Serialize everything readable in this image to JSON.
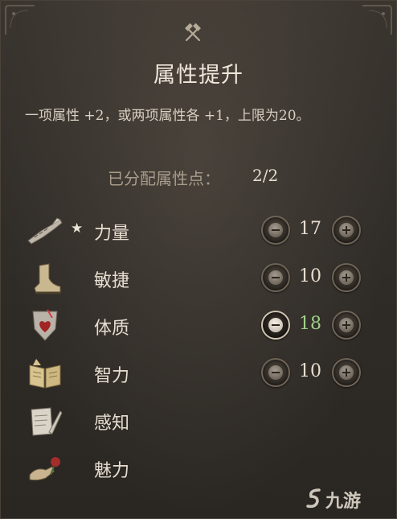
{
  "dialog": {
    "title": "属性提升",
    "description": "一项属性 +2，或两项属性各 +1，上限为20。",
    "points_label": "已分配属性点：",
    "points_value": "2/2"
  },
  "attributes": [
    {
      "name": "力量",
      "icon": "gauntlet-icon",
      "starred": true,
      "value": "17",
      "has_controls": true,
      "boosted": false
    },
    {
      "name": "敏捷",
      "icon": "boot-icon",
      "starred": false,
      "value": "10",
      "has_controls": true,
      "boosted": false
    },
    {
      "name": "体质",
      "icon": "heart-shield-icon",
      "starred": false,
      "value": "18",
      "has_controls": true,
      "boosted": true
    },
    {
      "name": "智力",
      "icon": "open-book-icon",
      "starred": false,
      "value": "10",
      "has_controls": true,
      "boosted": false
    },
    {
      "name": "感知",
      "icon": "scroll-icon",
      "starred": false,
      "value": "",
      "has_controls": false,
      "boosted": false
    },
    {
      "name": "魅力",
      "icon": "rose-hand-icon",
      "starred": false,
      "value": "",
      "has_controls": false,
      "boosted": false
    }
  ],
  "star_glyph": "★",
  "watermark": "九游",
  "colors": {
    "boosted_value": "#9fd18a",
    "background": "#2b2723"
  }
}
